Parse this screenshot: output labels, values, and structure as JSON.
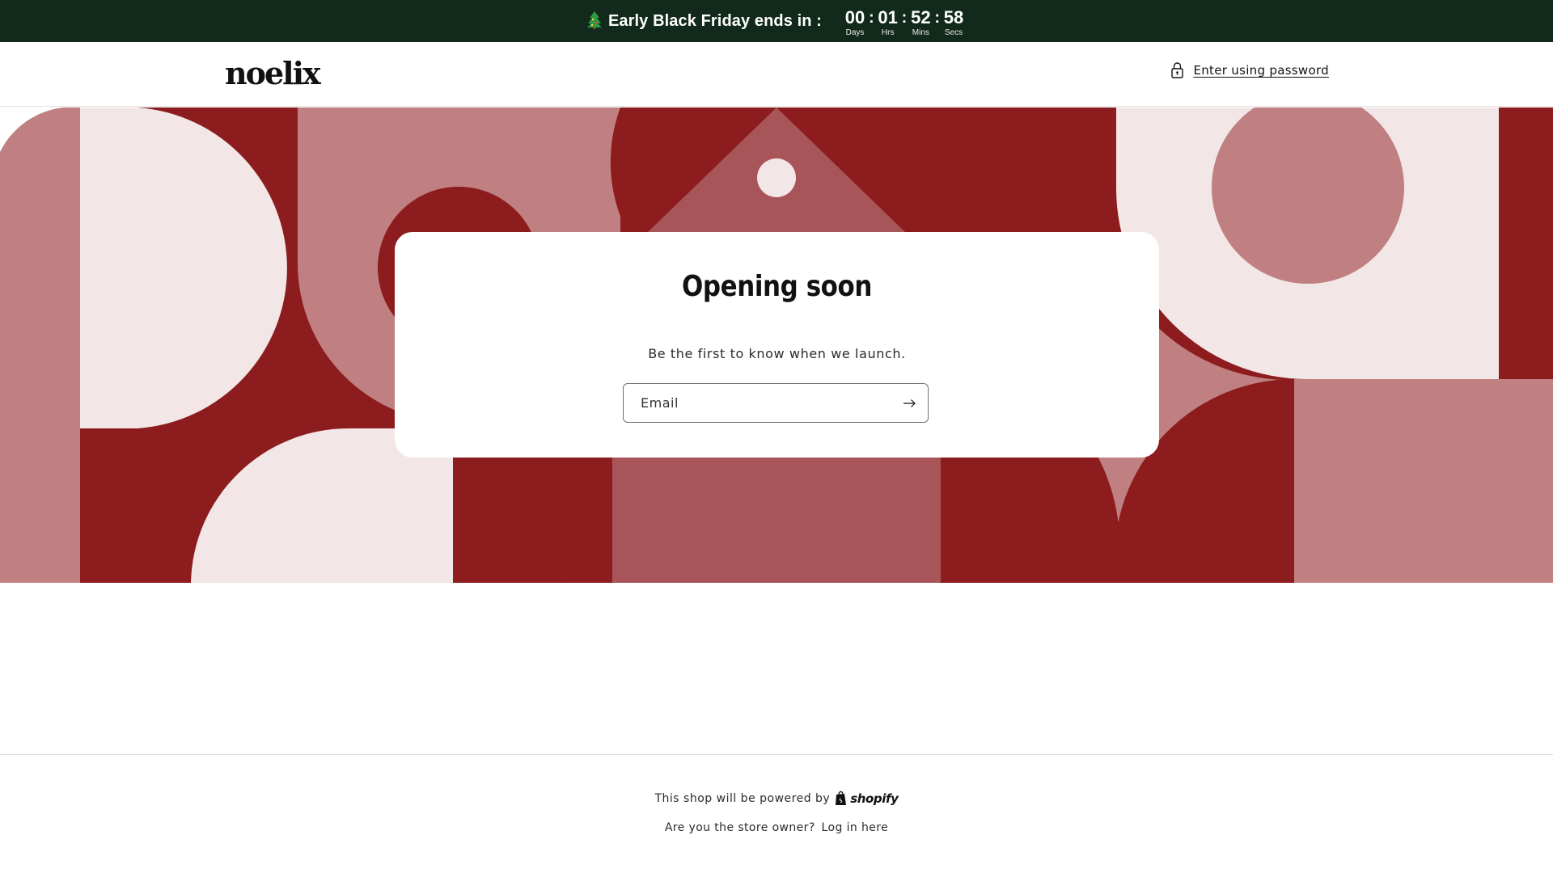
{
  "announcement": {
    "headline": "Early Black Friday ends in :",
    "icon": "christmas-tree-icon",
    "background": "#122a1c",
    "countdown": [
      {
        "value": "00",
        "label": "Days"
      },
      {
        "value": "01",
        "label": "Hrs"
      },
      {
        "value": "52",
        "label": "Mins"
      },
      {
        "value": "58",
        "label": "Secs"
      }
    ],
    "separator": ":"
  },
  "header": {
    "logo": "noelix",
    "password_link": "Enter using password",
    "password_icon": "lock-icon"
  },
  "banner": {
    "colors": {
      "dark": "#8c1c1d",
      "medium": "#a8555a",
      "rose": "#c08081",
      "light": "#f3e6e6"
    }
  },
  "newsletter": {
    "title": "Opening soon",
    "subtitle": "Be the first to know when we launch.",
    "email_placeholder": "Email",
    "submit_icon": "arrow-right-icon"
  },
  "footer": {
    "powered_text": "This shop will be powered by",
    "shopify_label": "shopify",
    "owner_question": "Are you the store owner?",
    "login_link": "Log in here"
  }
}
